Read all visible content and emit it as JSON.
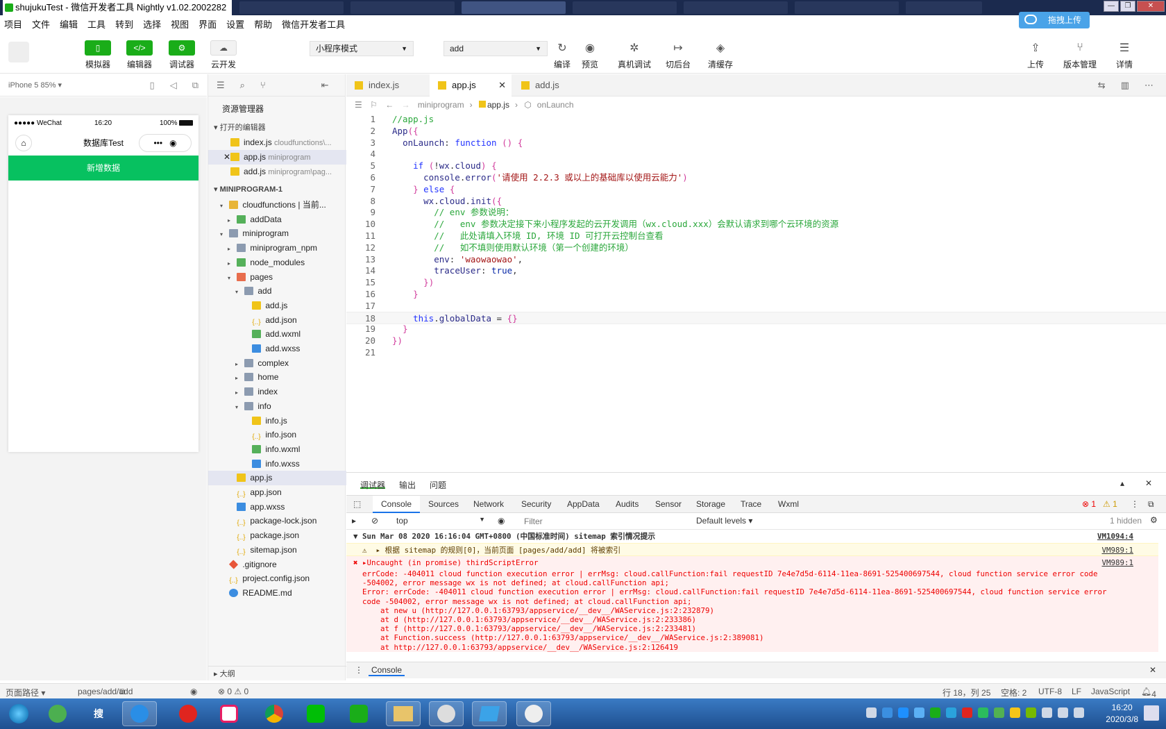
{
  "window": {
    "title": "shujukuTest - 微信开发者工具 Nightly v1.02.2002282",
    "controls": [
      "—",
      "❐",
      "✕"
    ]
  },
  "menu": [
    "项目",
    "文件",
    "编辑",
    "工具",
    "转到",
    "选择",
    "视图",
    "界面",
    "设置",
    "帮助",
    "微信开发者工具"
  ],
  "drag_upload": "拖拽上传",
  "toolbar": {
    "simulator": "模拟器",
    "editor": "编辑器",
    "debugger": "调试器",
    "cloud": "云开发",
    "mode_select": "小程序模式",
    "compile_select": "add",
    "compile": "编译",
    "preview": "预览",
    "real_debug": "真机调试",
    "background": "切后台",
    "clear_cache": "清缓存",
    "upload": "上传",
    "version": "版本管理",
    "details": "详情"
  },
  "simulator": {
    "device": "iPhone 5 85% ▾",
    "status_left": "●●●●● WeChat",
    "status_time": "16:20",
    "status_battery": "100%",
    "nav_title": "数据库Test",
    "capsule_more": "•••",
    "add_button": "新增数据"
  },
  "explorer": {
    "title": "资源管理器",
    "open_editors": "打开的编辑器",
    "open_files": [
      {
        "name": "index.js",
        "path": "cloudfunctions\\..."
      },
      {
        "name": "app.js",
        "path": "miniprogram"
      },
      {
        "name": "add.js",
        "path": "miniprogram\\pag..."
      }
    ],
    "project": "MINIPROGRAM-1",
    "tree": [
      {
        "name": "cloudfunctions | 当前...",
        "depth": 1,
        "icon": "folder yellow",
        "arrow": "▾"
      },
      {
        "name": "addData",
        "depth": 2,
        "icon": "folder green",
        "arrow": "▸"
      },
      {
        "name": "miniprogram",
        "depth": 1,
        "icon": "folder",
        "arrow": "▾"
      },
      {
        "name": "miniprogram_npm",
        "depth": 2,
        "icon": "folder",
        "arrow": "▸"
      },
      {
        "name": "node_modules",
        "depth": 2,
        "icon": "folder green",
        "arrow": "▸"
      },
      {
        "name": "pages",
        "depth": 2,
        "icon": "folder red",
        "arrow": "▾"
      },
      {
        "name": "add",
        "depth": 3,
        "icon": "folder",
        "arrow": "▾"
      },
      {
        "name": "add.js",
        "depth": 4,
        "icon": "js",
        "arrow": ""
      },
      {
        "name": "add.json",
        "depth": 4,
        "icon": "json",
        "arrow": ""
      },
      {
        "name": "add.wxml",
        "depth": 4,
        "icon": "wxml",
        "arrow": ""
      },
      {
        "name": "add.wxss",
        "depth": 4,
        "icon": "wxss",
        "arrow": ""
      },
      {
        "name": "complex",
        "depth": 3,
        "icon": "folder",
        "arrow": "▸"
      },
      {
        "name": "home",
        "depth": 3,
        "icon": "folder",
        "arrow": "▸"
      },
      {
        "name": "index",
        "depth": 3,
        "icon": "folder",
        "arrow": "▸"
      },
      {
        "name": "info",
        "depth": 3,
        "icon": "folder",
        "arrow": "▾"
      },
      {
        "name": "info.js",
        "depth": 4,
        "icon": "js",
        "arrow": ""
      },
      {
        "name": "info.json",
        "depth": 4,
        "icon": "json",
        "arrow": ""
      },
      {
        "name": "info.wxml",
        "depth": 4,
        "icon": "wxml",
        "arrow": ""
      },
      {
        "name": "info.wxss",
        "depth": 4,
        "icon": "wxss",
        "arrow": ""
      },
      {
        "name": "app.js",
        "depth": 2,
        "icon": "js",
        "arrow": "",
        "selected": true
      },
      {
        "name": "app.json",
        "depth": 2,
        "icon": "json",
        "arrow": ""
      },
      {
        "name": "app.wxss",
        "depth": 2,
        "icon": "wxss",
        "arrow": ""
      },
      {
        "name": "package-lock.json",
        "depth": 2,
        "icon": "json",
        "arrow": ""
      },
      {
        "name": "package.json",
        "depth": 2,
        "icon": "json",
        "arrow": ""
      },
      {
        "name": "sitemap.json",
        "depth": 2,
        "icon": "json",
        "arrow": ""
      },
      {
        "name": ".gitignore",
        "depth": 1,
        "icon": "git",
        "arrow": ""
      },
      {
        "name": "project.config.json",
        "depth": 1,
        "icon": "json",
        "arrow": ""
      },
      {
        "name": "README.md",
        "depth": 1,
        "icon": "info",
        "arrow": ""
      }
    ],
    "outline": "大纲"
  },
  "tabs": [
    {
      "name": "index.js",
      "active": false
    },
    {
      "name": "app.js",
      "active": true
    },
    {
      "name": "add.js",
      "active": false
    }
  ],
  "breadcrumb": [
    "miniprogram",
    "app.js",
    "onLaunch"
  ],
  "code_lines": [
    "//app.js",
    "App({",
    "  onLaunch: function () {",
    "",
    "    if (!wx.cloud) {",
    "      console.error('请使用 2.2.3 或以上的基础库以使用云能力')",
    "    } else {",
    "      wx.cloud.init({",
    "        // env 参数说明：",
    "        //   env 参数决定接下来小程序发起的云开发调用（wx.cloud.xxx）会默认请求到哪个云环境的资源",
    "        //   此处请填入环境 ID, 环境 ID 可打开云控制台查看",
    "        //   如不填则使用默认环境（第一个创建的环境）",
    "        env: 'waowaowao',",
    "        traceUser: true,",
    "      })",
    "    }",
    "",
    "    this.globalData = {}",
    "  }",
    "})",
    ""
  ],
  "panel": {
    "tabs": [
      "调试器",
      "输出",
      "问题"
    ],
    "devtools_tabs": [
      "Console",
      "Sources",
      "Network",
      "Security",
      "AppData",
      "Audits",
      "Sensor",
      "Storage",
      "Trace",
      "Wxml"
    ],
    "error_count": "1",
    "warning_count": "1",
    "context": "top",
    "filter_placeholder": "Filter",
    "levels": "Default levels ▾",
    "hidden": "1 hidden",
    "logs": [
      {
        "type": "group",
        "text": "▼ Sun Mar 08 2020 16:16:04 GMT+0800 (中国标准时间) sitemap 索引情况提示",
        "src": "VM1094:4"
      },
      {
        "type": "warn",
        "text": "  ⚠  ▸ 根据 sitemap 的规则[0]，当前页面 [pages/add/add] 将被索引",
        "src": "VM989:1"
      },
      {
        "type": "err",
        "text": "✖ ▸Uncaught (in promise) thirdScriptError",
        "src": "VM989:1"
      },
      {
        "type": "err",
        "text": "  errCode: -404011 cloud function execution error | errMsg: cloud.callFunction:fail requestID 7e4e7d5d-6114-11ea-8691-525400697544, cloud function service error code"
      },
      {
        "type": "err",
        "text": "  -504002, error message wx is not defined; at cloud.callFunction api;"
      },
      {
        "type": "err",
        "text": "  Error: errCode: -404011 cloud function execution error | errMsg: cloud.callFunction:fail requestID 7e4e7d5d-6114-11ea-8691-525400697544, cloud function service error"
      },
      {
        "type": "err",
        "text": "  code -504002, error message wx is not defined; at cloud.callFunction api;"
      },
      {
        "type": "err",
        "text": "      at new u (http://127.0.0.1:63793/appservice/__dev__/WAService.js:2:232879)"
      },
      {
        "type": "err",
        "text": "      at d (http://127.0.0.1:63793/appservice/__dev__/WAService.js:2:233386)"
      },
      {
        "type": "err",
        "text": "      at f (http://127.0.0.1:63793/appservice/__dev__/WAService.js:2:233481)"
      },
      {
        "type": "err",
        "text": "      at Function.success (http://127.0.0.1:63793/appservice/__dev__/WAService.js:2:389081)"
      },
      {
        "type": "err",
        "text": "      at http://127.0.0.1:63793/appservice/__dev__/WAService.js:2:126419"
      }
    ],
    "console_drawer": "Console"
  },
  "status": {
    "page_path_label": "页面路径 ▾",
    "page_path": "pages/add/add",
    "problems": "⊗ 0 ⚠ 0",
    "position": "行 18，列 25",
    "spaces": "空格: 2",
    "encoding": "UTF-8",
    "eol": "LF",
    "language": "JavaScript",
    "notifications": "4"
  },
  "taskbar": {
    "apps": [
      "start",
      "360",
      "搜",
      "browser",
      "music",
      "youku",
      "chrome",
      "iqiyi",
      "wechat-player",
      "folder",
      "panda",
      "dev",
      "wechat-dev"
    ],
    "time": "16:20",
    "date": "2020/3/8"
  }
}
